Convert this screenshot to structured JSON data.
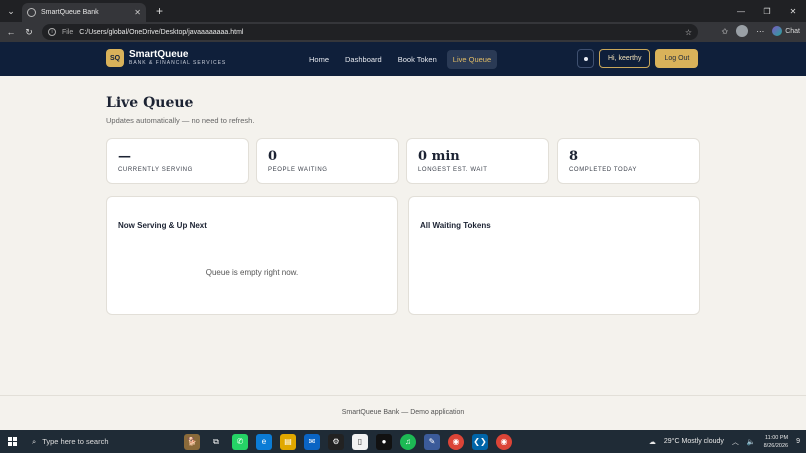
{
  "browser": {
    "tab_title": "SmartQueue Bank",
    "url_prefix": "File",
    "url": "C:/Users/global/OneDrive/Desktop/javaaaaaaaa.html",
    "chat_label": "Chat"
  },
  "header": {
    "logo_badge": "SQ",
    "brand_name": "SmartQueue",
    "brand_sub": "BANK & FINANCIAL SERVICES",
    "nav": [
      "Home",
      "Dashboard",
      "Book Token",
      "Live Queue"
    ],
    "active_nav": "Live Queue",
    "user_label": "Hi, keerthy",
    "logout_label": "Log Out"
  },
  "page": {
    "title": "Live Queue",
    "subtitle": "Updates automatically — no need to refresh."
  },
  "stats": [
    {
      "value": "—",
      "label": "CURRENTLY SERVING"
    },
    {
      "value": "0",
      "label": "PEOPLE WAITING"
    },
    {
      "value": "0 min",
      "label": "LONGEST EST. WAIT"
    },
    {
      "value": "8",
      "label": "COMPLETED TODAY"
    }
  ],
  "panels": {
    "serving_title": "Now Serving & Up Next",
    "serving_empty": "Queue is empty right now.",
    "waiting_title": "All Waiting Tokens"
  },
  "footer": {
    "text": "SmartQueue Bank — Demo application"
  },
  "taskbar": {
    "search_placeholder": "Type here to search",
    "weather": "29°C  Mostly cloudy",
    "time": "11:00 PM",
    "date": "8/26/2026",
    "notification_count": "9"
  },
  "colors": {
    "nav_bg": "#0f1f3a",
    "accent_gold": "#d9b25a",
    "page_bg": "#f4f2ed"
  }
}
